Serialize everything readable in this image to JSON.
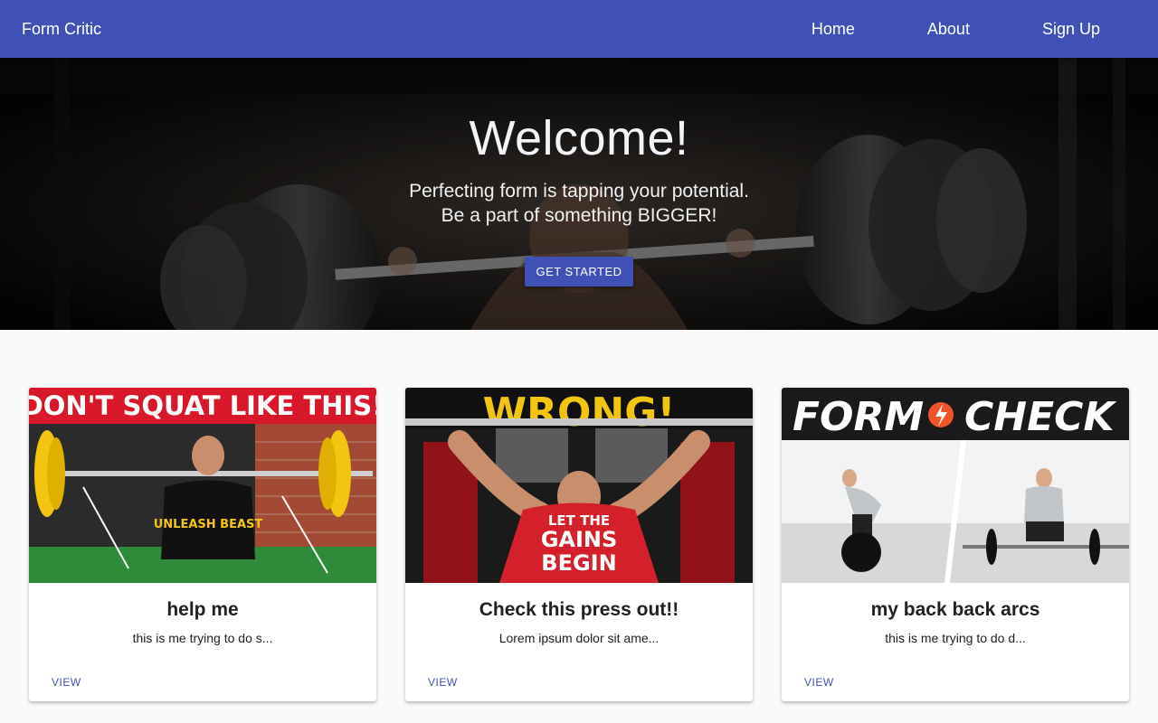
{
  "navbar": {
    "brand": "Form Critic",
    "links": [
      {
        "label": "Home"
      },
      {
        "label": "About"
      },
      {
        "label": "Sign Up"
      }
    ],
    "color": "#3f51b5"
  },
  "hero": {
    "title": "Welcome!",
    "line1": "Perfecting form is tapping your potential.",
    "line2": "Be a part of something BIGGER!",
    "cta_label": "GET STARTED"
  },
  "cards": [
    {
      "thumb_text": "DON'T SQUAT LIKE THIS!",
      "shirt_text": "UNLEASH BEAST",
      "title": "help me",
      "description": "this is me trying to do s...",
      "action": "VIEW"
    },
    {
      "thumb_text": "WRONG!",
      "shirt_text_1": "LET THE",
      "shirt_text_2": "GAINS",
      "shirt_text_3": "BEGIN",
      "title": "Check this press out!!",
      "description": "Lorem ipsum dolor sit ame...",
      "action": "VIEW"
    },
    {
      "thumb_text_left": "FORM",
      "thumb_text_right": "CHECK",
      "title": "my back back arcs",
      "description": "this is me trying to do d...",
      "action": "VIEW"
    }
  ]
}
